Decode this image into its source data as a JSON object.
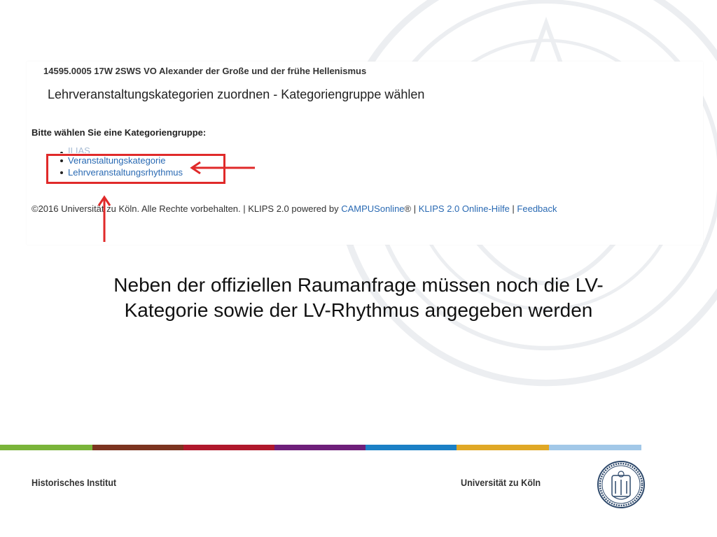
{
  "screenshot": {
    "course_title": "14595.0005 17W 2SWS VO Alexander der Große und der frühe Hellenismus",
    "page_heading": "Lehrveranstaltungskategorien zuordnen - Kategoriengruppe wählen",
    "prompt": "Bitte wählen Sie eine Kategoriengruppe:",
    "categories": [
      {
        "label": "ILIAS"
      },
      {
        "label": "Veranstaltungskategorie"
      },
      {
        "label": "Lehrveranstaltungsrhythmus"
      }
    ],
    "footer": {
      "copyright": "©2016 Universität zu Köln. Alle Rechte vorbehalten. | KLIPS 2.0 powered by ",
      "campus_link": "CAMPUSonline",
      "reg": "® | ",
      "help_link": "KLIPS 2.0 Online-Hilfe",
      "sep": " | ",
      "feedback_link": "Feedback"
    }
  },
  "caption": {
    "line1": "Neben der offiziellen Raumanfrage müssen noch die LV-",
    "line2": "Kategorie sowie der LV-Rhythmus angegeben werden"
  },
  "slide_footer": {
    "left": "Historisches Institut",
    "right": "Universität zu Köln"
  },
  "colors": {
    "highlight": "#e02a2a",
    "link": "#2a6ab3",
    "stripes": [
      "#7ab43a",
      "#7c3420",
      "#b0182c",
      "#6e1f7a",
      "#1b80c6",
      "#e0a826",
      "#a2c8e8"
    ]
  },
  "icons": {
    "seal": "university-seal-icon",
    "arrow": "red-arrow-icon"
  }
}
